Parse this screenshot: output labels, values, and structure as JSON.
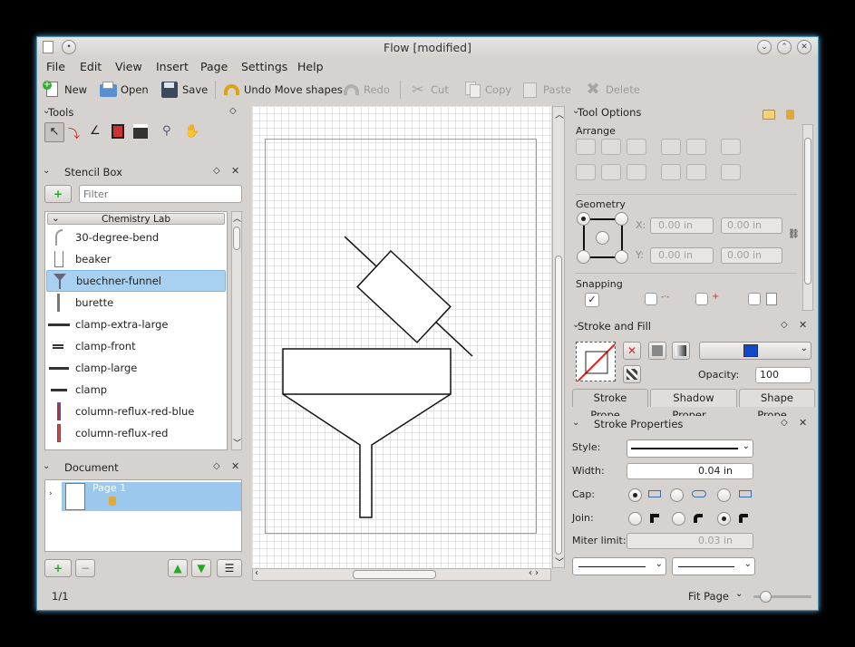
{
  "window": {
    "title": "Flow [modified]"
  },
  "menu": [
    "File",
    "Edit",
    "View",
    "Insert",
    "Page",
    "Settings",
    "Help"
  ],
  "toolbar": {
    "new": "New",
    "open": "Open",
    "save": "Save",
    "undo": "Undo Move shapes",
    "redo": "Redo",
    "cut": "Cut",
    "copy": "Copy",
    "paste": "Paste",
    "delete": "Delete"
  },
  "tools_panel": {
    "title": "Tools"
  },
  "stencil_box": {
    "title": "Stencil Box",
    "filter_placeholder": "Filter",
    "category": "Chemistry Lab",
    "items": [
      "30-degree-bend",
      "beaker",
      "buechner-funnel",
      "burette",
      "clamp-extra-large",
      "clamp-front",
      "clamp-large",
      "clamp",
      "column-reflux-red-blue",
      "column-reflux-red"
    ],
    "selected": "buechner-funnel"
  },
  "document_panel": {
    "title": "Document",
    "page_label": "Page 1"
  },
  "tool_options": {
    "title": "Tool Options",
    "arrange_label": "Arrange",
    "geometry_label": "Geometry",
    "x_label": "X:",
    "y_label": "Y:",
    "x_value": "0.00 in",
    "x2_value": "0.00 in",
    "y_value": "0.00 in",
    "y2_value": "0.00 in",
    "snapping_label": "Snapping"
  },
  "stroke_fill": {
    "title": "Stroke and Fill",
    "opacity_label": "Opacity:",
    "opacity_value": "100",
    "fill_color": "#1048c8",
    "tabs": [
      "Stroke Prope...",
      "Shadow Proper...",
      "Shape Prope..."
    ]
  },
  "stroke_properties": {
    "title": "Stroke Properties",
    "style_label": "Style:",
    "width_label": "Width:",
    "width_value": "0.04 in",
    "cap_label": "Cap:",
    "join_label": "Join:",
    "miter_label": "Miter limit:",
    "miter_value": "0.03 in"
  },
  "status": {
    "page": "1/1",
    "zoom": "Fit Page"
  },
  "colors": {
    "accent": "#a4c8ea",
    "selection": "#9cc8ee",
    "window_bg": "#d6d2d0"
  }
}
